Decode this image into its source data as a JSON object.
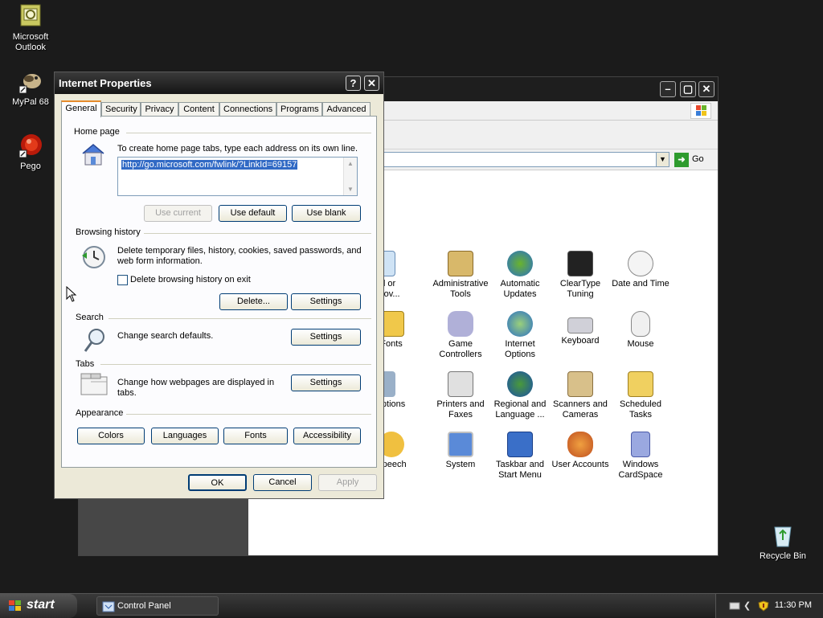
{
  "desktop": {
    "icons": [
      {
        "label": "Microsoft Outlook",
        "icon": "outlook-icon"
      },
      {
        "label": "MyPal 68",
        "icon": "mypal-icon"
      },
      {
        "label": "Pego",
        "icon": "pego-icon"
      },
      {
        "label": "Recycle Bin",
        "icon": "recycle-bin-icon"
      }
    ]
  },
  "control_panel": {
    "address": {
      "go_label": "Go"
    },
    "items": [
      {
        "label": "Add or Remov...",
        "icon": "add-remove-programs-icon"
      },
      {
        "label": "Administrative Tools",
        "icon": "administrative-tools-icon"
      },
      {
        "label": "Automatic Updates",
        "icon": "automatic-updates-icon"
      },
      {
        "label": "ClearType Tuning",
        "icon": "cleartype-icon"
      },
      {
        "label": "Date and Time",
        "icon": "date-time-icon"
      },
      {
        "label": "Fonts",
        "icon": "fonts-icon"
      },
      {
        "label": "Game Controllers",
        "icon": "game-controllers-icon"
      },
      {
        "label": "Internet Options",
        "icon": "internet-options-icon"
      },
      {
        "label": "Keyboard",
        "icon": "keyboard-icon"
      },
      {
        "label": "Mouse",
        "icon": "mouse-icon"
      },
      {
        "label": "ver Options",
        "icon": "power-options-icon"
      },
      {
        "label": "Printers and Faxes",
        "icon": "printers-icon"
      },
      {
        "label": "Regional and Language ...",
        "icon": "regional-icon"
      },
      {
        "label": "Scanners and Cameras",
        "icon": "scanners-icon"
      },
      {
        "label": "Scheduled Tasks",
        "icon": "scheduled-tasks-icon"
      },
      {
        "label": "Speech",
        "icon": "speech-icon"
      },
      {
        "label": "System",
        "icon": "system-icon"
      },
      {
        "label": "Taskbar and Start Menu",
        "icon": "taskbar-icon"
      },
      {
        "label": "User Accounts",
        "icon": "user-accounts-icon"
      },
      {
        "label": "Windows CardSpace",
        "icon": "cardspace-icon"
      }
    ]
  },
  "dialog": {
    "title": "Internet Properties",
    "help_button": "?",
    "close_button": "✕",
    "tabs": [
      "General",
      "Security",
      "Privacy",
      "Content",
      "Connections",
      "Programs",
      "Advanced"
    ],
    "active_tab": "General",
    "home_page": {
      "section": "Home page",
      "description": "To create home page tabs, type each address on its own line.",
      "url": "http://go.microsoft.com/fwlink/?LinkId=69157",
      "buttons": {
        "use_current": "Use current",
        "use_default": "Use default",
        "use_blank": "Use blank"
      }
    },
    "browsing_history": {
      "section": "Browsing history",
      "description_line1": "Delete temporary files, history, cookies, saved passwords, and",
      "description_line2": "web form information.",
      "checkbox_label": "Delete browsing history on exit",
      "checkbox_checked": false,
      "buttons": {
        "delete": "Delete...",
        "settings": "Settings"
      }
    },
    "search": {
      "section": "Search",
      "description": "Change search defaults.",
      "settings": "Settings"
    },
    "tabs_section": {
      "section": "Tabs",
      "description_line1": "Change how webpages are displayed in",
      "description_line2": "tabs.",
      "settings": "Settings"
    },
    "appearance": {
      "section": "Appearance",
      "buttons": {
        "colors": "Colors",
        "languages": "Languages",
        "fonts": "Fonts",
        "accessibility": "Accessibility"
      }
    },
    "footer": {
      "ok": "OK",
      "cancel": "Cancel",
      "apply": "Apply"
    }
  },
  "taskbar": {
    "start_label": "start",
    "task": "Control Panel",
    "clock": "11:30 PM"
  },
  "colors": {
    "desktop_bg": "#1b1b1b",
    "dialog_bg": "#ece9d8",
    "selection": "#316ac5",
    "active_tab_accent": "#e68b2c"
  }
}
